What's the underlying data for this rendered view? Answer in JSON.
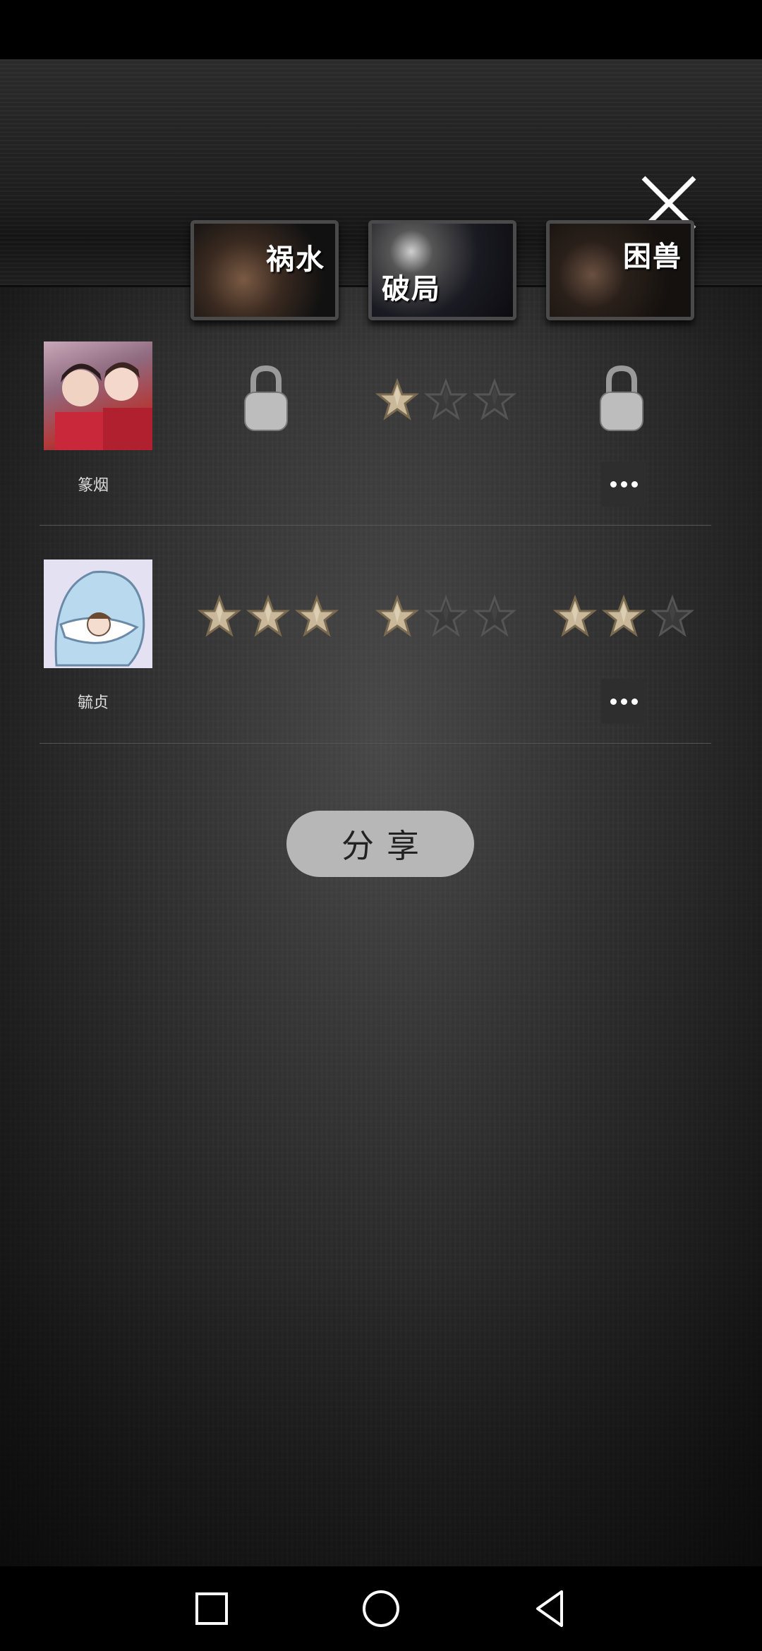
{
  "levels": [
    {
      "title": "祸水"
    },
    {
      "title": "破局"
    },
    {
      "title": "困兽"
    }
  ],
  "players": [
    {
      "name": "篆烟",
      "results": [
        {
          "locked": true
        },
        {
          "locked": false,
          "stars": 1
        },
        {
          "locked": true
        }
      ]
    },
    {
      "name": "毓贞",
      "results": [
        {
          "locked": false,
          "stars": 3
        },
        {
          "locked": false,
          "stars": 1
        },
        {
          "locked": false,
          "stars": 2
        }
      ]
    }
  ],
  "share_button": {
    "label": "分享"
  },
  "icons": {
    "close": "close-icon",
    "more": "more-icon",
    "lock": "lock-icon",
    "star": "star-icon",
    "nav_recent": "square-icon",
    "nav_home": "circle-icon",
    "nav_back": "triangle-back-icon"
  }
}
